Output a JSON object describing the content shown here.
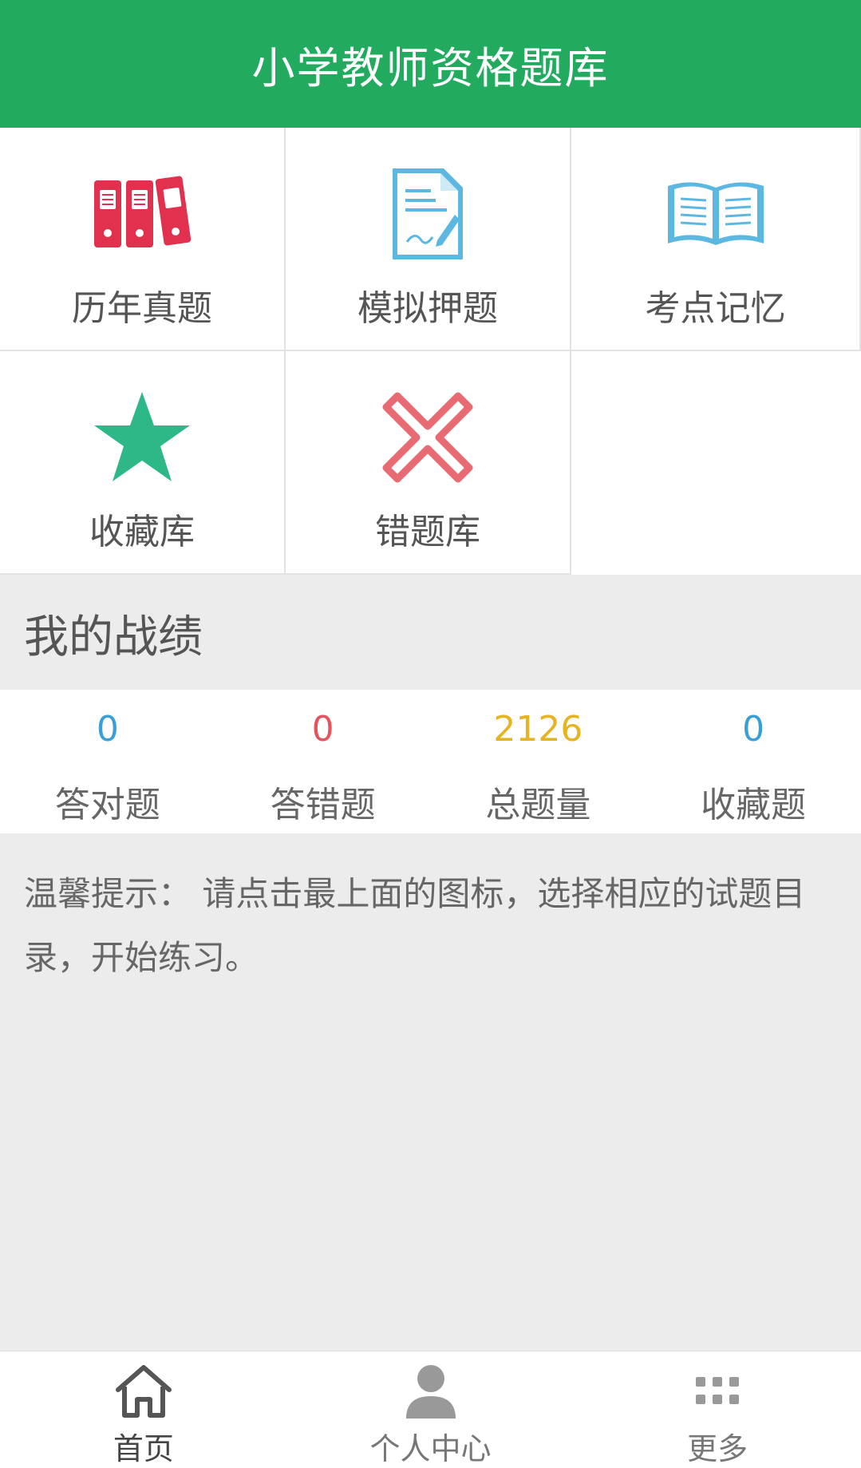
{
  "header": {
    "title": "小学教师资格题库"
  },
  "menu": [
    {
      "label": "历年真题",
      "icon": "binders-icon"
    },
    {
      "label": "模拟押题",
      "icon": "document-pen-icon"
    },
    {
      "label": "考点记忆",
      "icon": "open-book-icon"
    },
    {
      "label": "收藏库",
      "icon": "star-icon"
    },
    {
      "label": "错题库",
      "icon": "cross-icon"
    }
  ],
  "section": {
    "title": "我的战绩"
  },
  "stats": [
    {
      "value": "0",
      "label": "答对题",
      "color": "#3a9fd6"
    },
    {
      "value": "0",
      "label": "答错题",
      "color": "#e8525c"
    },
    {
      "value": "2126",
      "label": "总题量",
      "color": "#e6b423"
    },
    {
      "value": "0",
      "label": "收藏题",
      "color": "#3a9fd6"
    }
  ],
  "tip": {
    "text": "温馨提示： 请点击最上面的图标，选择相应的试题目录，开始练习。"
  },
  "tabs": [
    {
      "label": "首页",
      "icon": "home-icon"
    },
    {
      "label": "个人中心",
      "icon": "user-icon"
    },
    {
      "label": "更多",
      "icon": "more-icon"
    }
  ],
  "colors": {
    "header_bg": "#22ab5f",
    "binders": "#e2304f",
    "document": "#5cb8e0",
    "book": "#5cb8e0",
    "star": "#2eb887",
    "cross": "#e86b73"
  }
}
